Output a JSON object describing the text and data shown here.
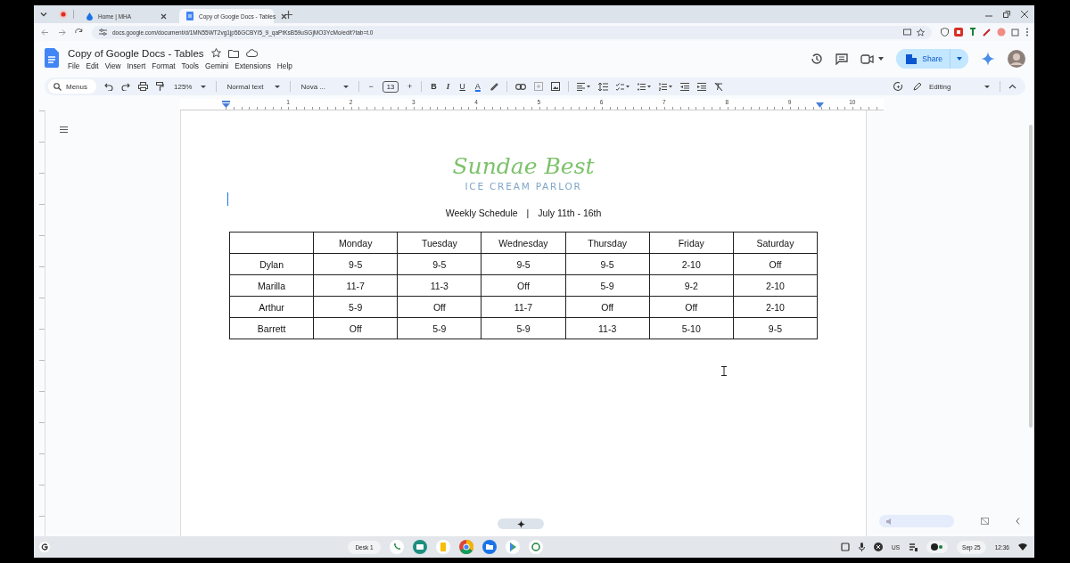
{
  "browser": {
    "tabs": [
      {
        "title": "Home | MHA",
        "selected": false
      },
      {
        "title": "Copy of Google Docs - Tables",
        "selected": true
      }
    ],
    "url": "docs.google.com/document/d/1MN55WT2vg1jp56GCBYI5_9_qaPtKsB59uSGjMO3YcMo/edit?tab=t.0"
  },
  "docs": {
    "title": "Copy of Google Docs - Tables",
    "menus": [
      "File",
      "Edit",
      "View",
      "Insert",
      "Format",
      "Tools",
      "Gemini",
      "Extensions",
      "Help"
    ],
    "share": "Share"
  },
  "toolbar": {
    "search": "Menus",
    "zoom": "125%",
    "style": "Normal text",
    "font": "Nova ...",
    "size_minus": "−",
    "font_size": "13",
    "size_plus": "+",
    "format_buttons": [
      {
        "label": "B",
        "kind": "bold"
      },
      {
        "label": "I",
        "kind": "italic"
      },
      {
        "label": "U",
        "kind": "underline"
      },
      {
        "label": "A",
        "kind": "color"
      }
    ],
    "mode": "Editing"
  },
  "ruler": [
    "1",
    "2",
    "3",
    "4",
    "5",
    "6",
    "7",
    "8",
    "9",
    "10"
  ],
  "document": {
    "logo": "Sundae Best",
    "tagline": "ICE CREAM PARLOR",
    "heading": [
      "Weekly Schedule",
      "|",
      "July 11th - 16th"
    ],
    "table": {
      "columns": [
        "Monday",
        "Tuesday",
        "Wednesday",
        "Thursday",
        "Friday",
        "Saturday"
      ],
      "rows": [
        {
          "name": "Dylan",
          "cells": [
            "9-5",
            "9-5",
            "9-5",
            "9-5",
            "2-10",
            "Off"
          ]
        },
        {
          "name": "Marilla",
          "cells": [
            "11-7",
            "11-3",
            "Off",
            "5-9",
            "9-2",
            "2-10"
          ]
        },
        {
          "name": "Arthur",
          "cells": [
            "5-9",
            "Off",
            "11-7",
            "Off",
            "Off",
            "2-10"
          ]
        },
        {
          "name": "Barrett",
          "cells": [
            "Off",
            "5-9",
            "5-9",
            "11-3",
            "5-10",
            "9-5"
          ]
        }
      ]
    }
  },
  "shelf": {
    "desk": "Desk 1",
    "input": "US",
    "date": "Sep 25",
    "time": "12:36"
  }
}
